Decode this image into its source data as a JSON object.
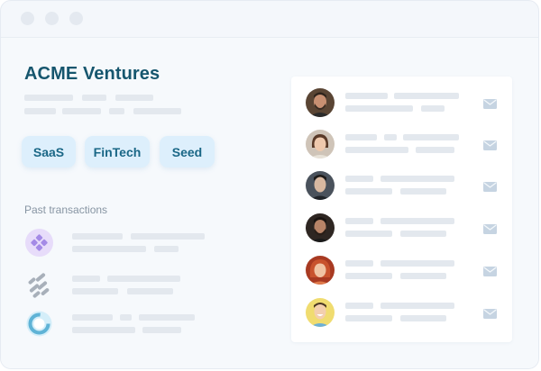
{
  "window": {
    "controls": [
      "close-dot",
      "minimize-dot",
      "maximize-dot"
    ]
  },
  "company": {
    "name": "ACME Ventures"
  },
  "tags": [
    "SaaS",
    "FinTech",
    "Seed"
  ],
  "transactions": {
    "label": "Past transactions",
    "items": [
      {
        "logo": "purple-diamond-logo",
        "color": "#a990e8"
      },
      {
        "logo": "grid-stripes-logo",
        "color": "#9aa3ae"
      },
      {
        "logo": "ring-logo",
        "color": "#60b6d8"
      }
    ]
  },
  "contacts": [
    {
      "avatar": "avatar-man-beard",
      "bg": "#4b3a2e",
      "icon": "mail-icon"
    },
    {
      "avatar": "avatar-woman-bob",
      "bg": "#6a4a38",
      "icon": "mail-icon"
    },
    {
      "avatar": "avatar-man-dark",
      "bg": "#3d4550",
      "icon": "mail-icon"
    },
    {
      "avatar": "avatar-man-beard-2",
      "bg": "#3a302c",
      "icon": "mail-icon"
    },
    {
      "avatar": "avatar-woman-red-hair",
      "bg": "#b7452a",
      "icon": "mail-icon"
    },
    {
      "avatar": "avatar-man-smiling",
      "bg": "#e8d25a",
      "icon": "mail-icon"
    }
  ]
}
